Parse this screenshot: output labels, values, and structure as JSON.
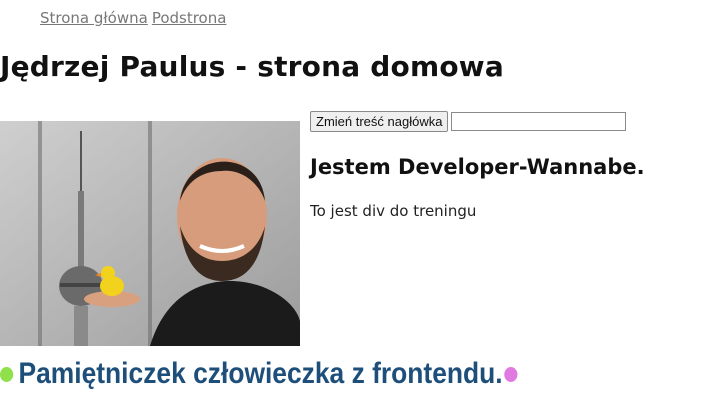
{
  "nav": {
    "home": "Strona główna",
    "subpage": "Podstrona"
  },
  "header": {
    "title": "Jędrzej Paulus - strona domowa"
  },
  "controls": {
    "button_label": "Zmień treść nagłówka",
    "input_value": ""
  },
  "content": {
    "heading": "Jestem Developer-Wannabe.",
    "paragraph": "To jest div do treningu"
  },
  "photo": {
    "description_icon": "portrait-photo"
  },
  "tagline": {
    "text": "Pamiętniczek człowieczka z frontendu."
  },
  "colors": {
    "tagline": "#1e4f7a",
    "dot_left": "#8fe04a",
    "dot_right": "#e07ae0",
    "nav_link": "#777777"
  }
}
